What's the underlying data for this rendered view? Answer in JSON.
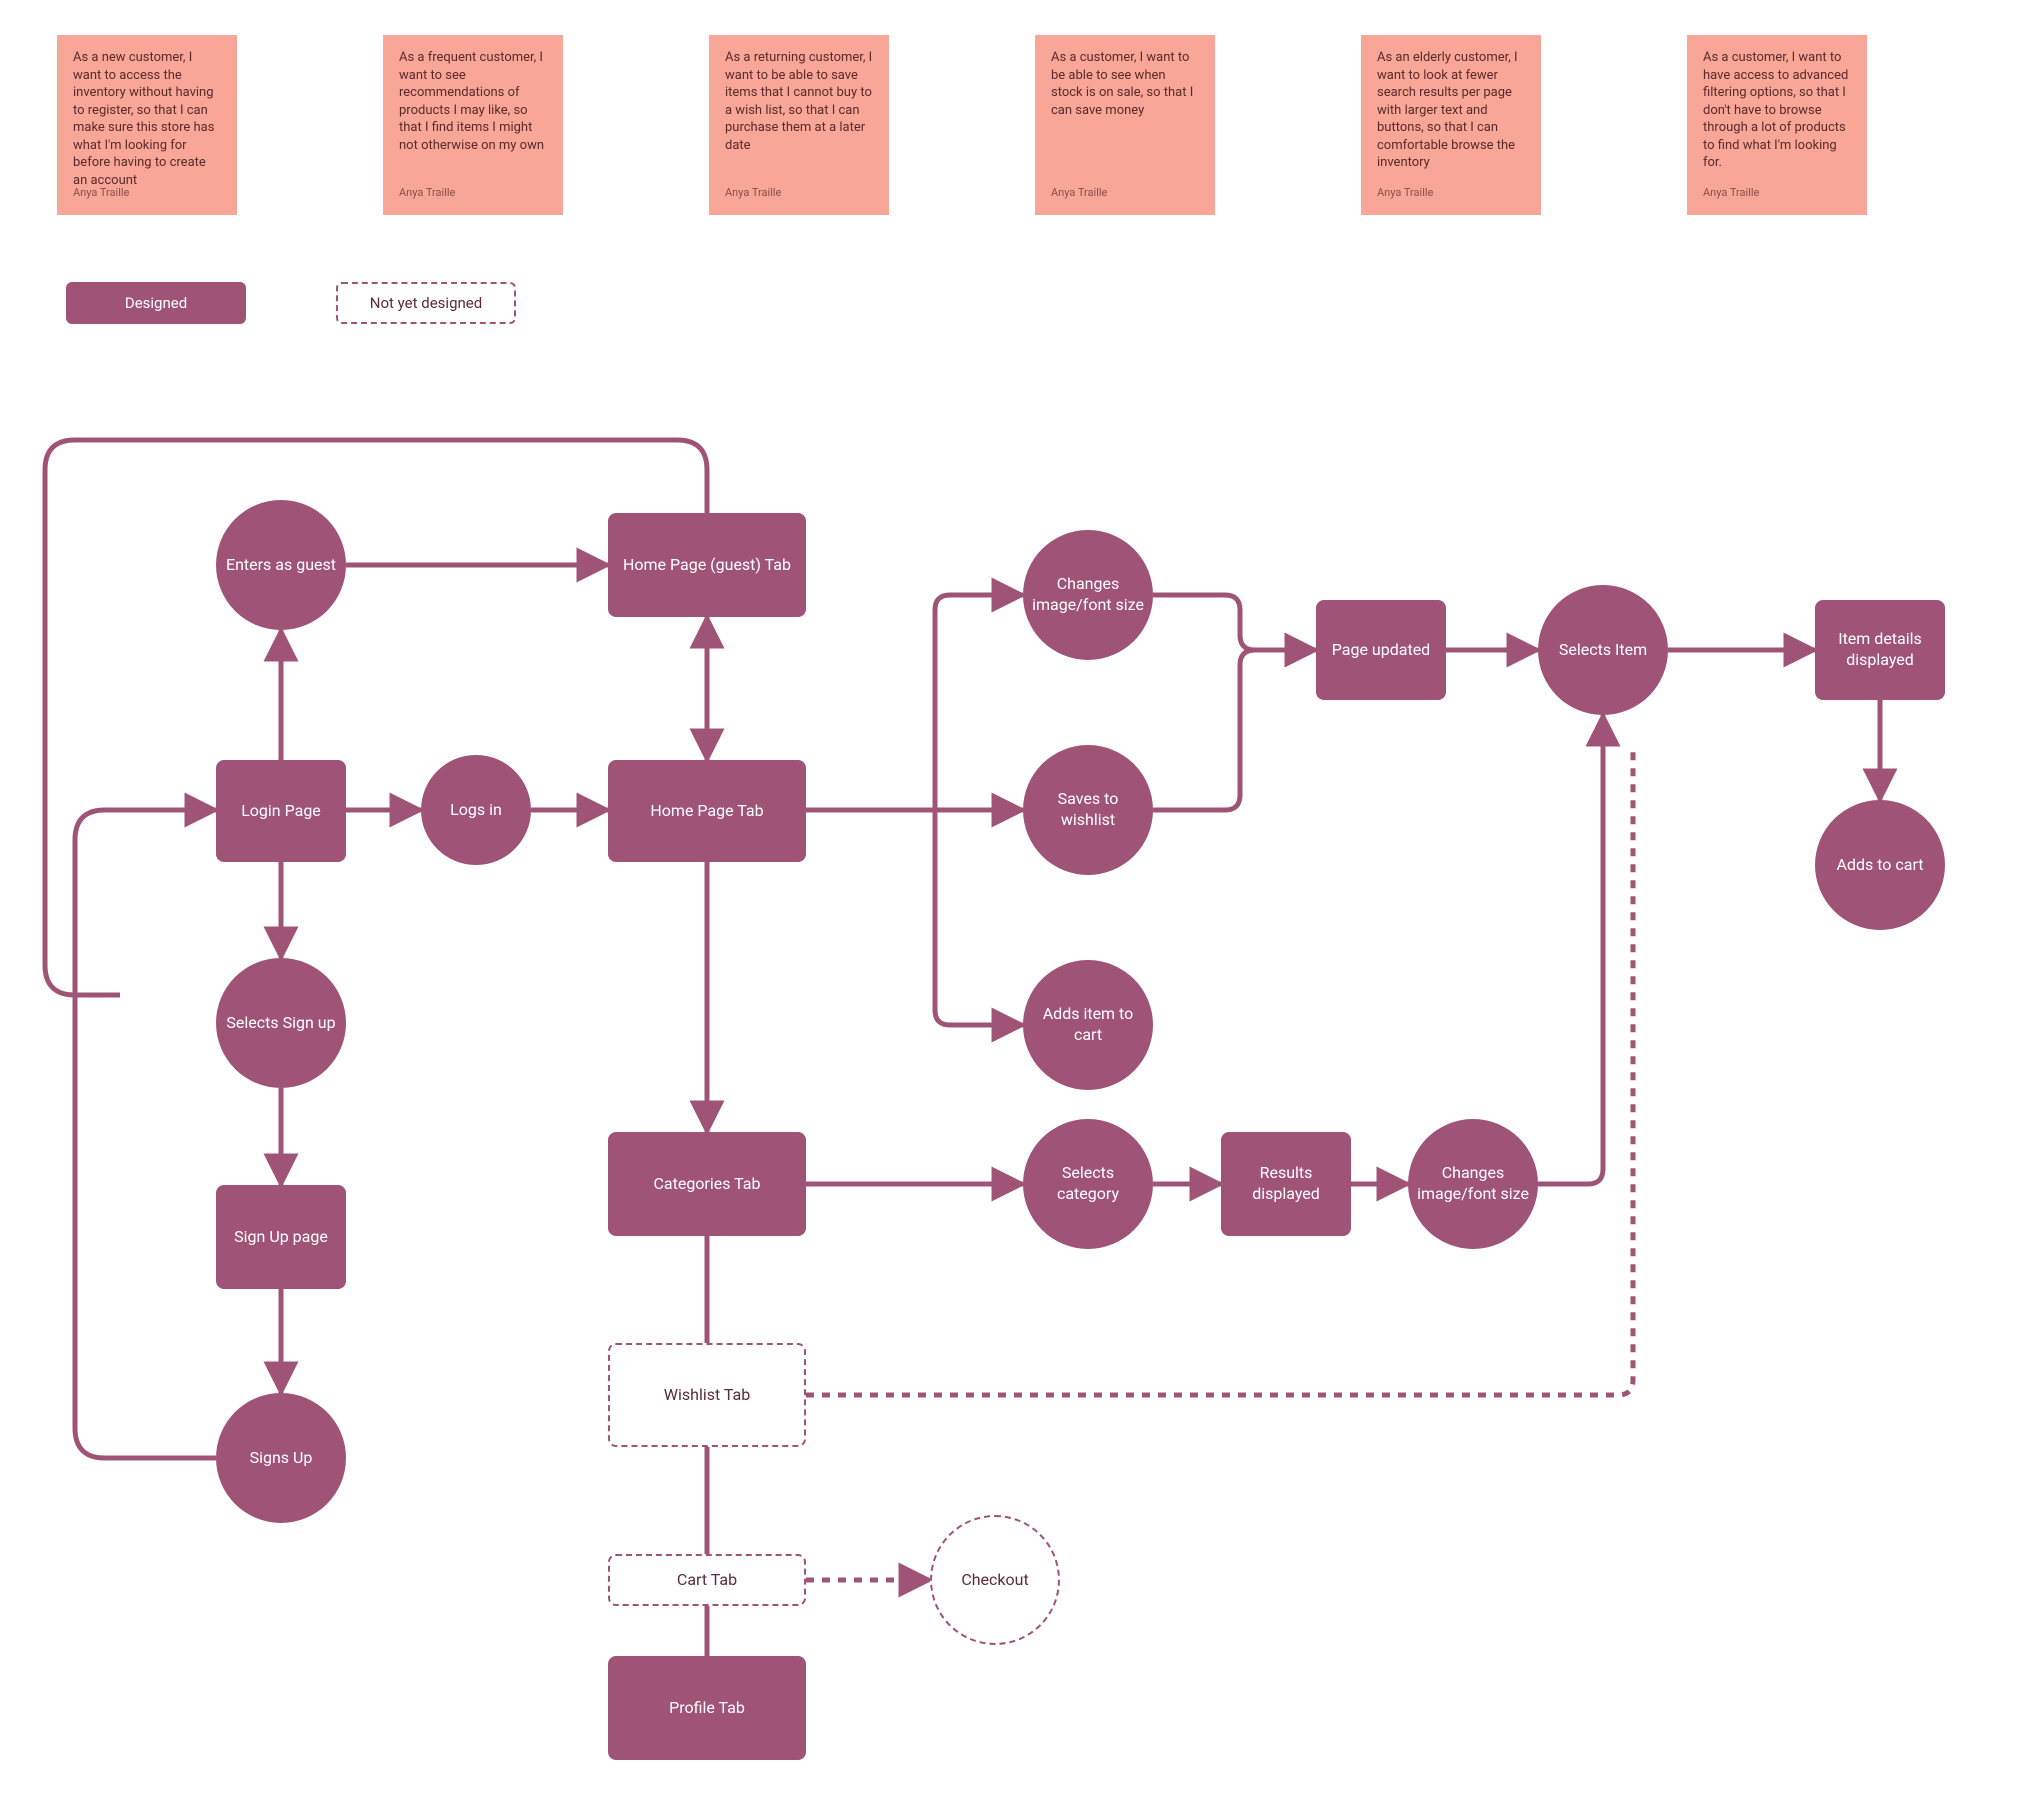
{
  "stickies": [
    {
      "text": "As a new customer, I want to access the inventory without having to register, so that I can make sure this store has what I'm looking for before having to create an account",
      "author": "Anya Traille"
    },
    {
      "text": "As a frequent customer, I want to see recommendations of products I may like, so that I find items I might not otherwise on my own",
      "author": "Anya Traille"
    },
    {
      "text": "As a returning customer, I want to be able to save items that I cannot buy to a wish list, so that I can purchase them at a later date",
      "author": "Anya Traille"
    },
    {
      "text": "As a customer, I want to be able to see when stock is on sale, so that I can save money",
      "author": "Anya Traille"
    },
    {
      "text": "As an elderly customer, I want to look at fewer search results per page with larger text and buttons, so that I can comfortable browse the inventory",
      "author": "Anya Traille"
    },
    {
      "text": "As a customer, I want to have access to advanced filtering options, so that I don't have to browse through a lot of products to find what I'm looking for.",
      "author": "Anya Traille"
    }
  ],
  "legend": {
    "designed": "Designed",
    "not_designed": "Not yet designed"
  },
  "nodes": {
    "enters_guest": {
      "label": "Enters as guest"
    },
    "home_guest": {
      "label": "Home Page (guest) Tab"
    },
    "login_page": {
      "label": "Login Page"
    },
    "logs_in": {
      "label": "Logs in"
    },
    "home_page": {
      "label": "Home Page Tab"
    },
    "changes_size_1": {
      "label": "Changes image/font size"
    },
    "saves_wishlist": {
      "label": "Saves to wishlist"
    },
    "adds_to_cart_1": {
      "label": "Adds item to cart"
    },
    "page_updated": {
      "label": "Page updated"
    },
    "selects_item": {
      "label": "Selects Item"
    },
    "item_details": {
      "label": "Item details displayed"
    },
    "adds_to_cart_2": {
      "label": "Adds to cart"
    },
    "selects_signup": {
      "label": "Selects Sign up"
    },
    "signup_page": {
      "label": "Sign Up page"
    },
    "signs_up": {
      "label": "Signs Up"
    },
    "categories_tab": {
      "label": "Categories Tab"
    },
    "selects_category": {
      "label": "Selects category"
    },
    "results_displayed": {
      "label": "Results displayed"
    },
    "changes_size_2": {
      "label": "Changes image/font size"
    },
    "wishlist_tab": {
      "label": "Wishlist Tab"
    },
    "cart_tab": {
      "label": "Cart Tab"
    },
    "checkout": {
      "label": "Checkout"
    },
    "profile_tab": {
      "label": "Profile Tab"
    }
  }
}
